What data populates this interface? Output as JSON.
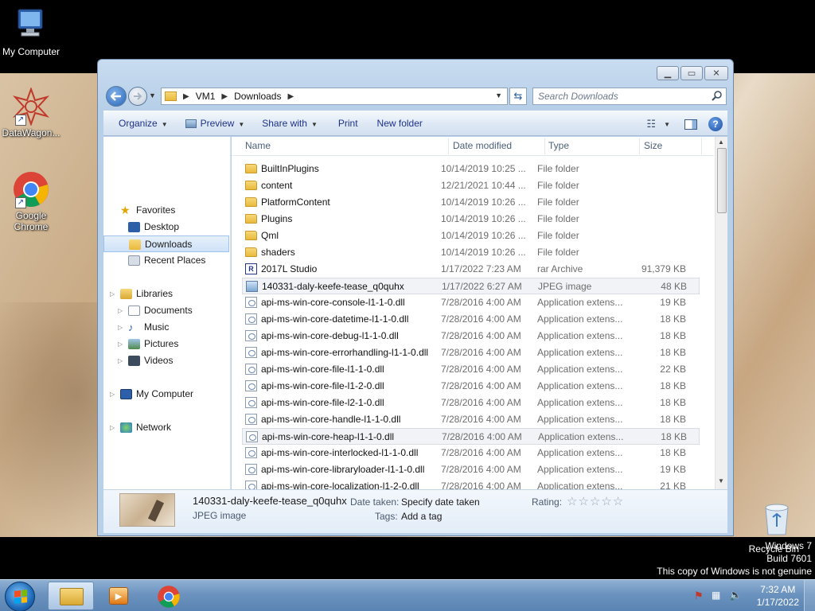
{
  "desktop": {
    "icons": [
      {
        "label": "My Computer"
      },
      {
        "label": "DataWagon..."
      },
      {
        "label": "Google Chrome"
      }
    ],
    "recycle_bin": "Recycle Bin",
    "genuine": {
      "line1": "Windows 7",
      "line2": "Build 7601",
      "line3": "This copy of Windows is not genuine"
    }
  },
  "window": {
    "address": {
      "crumbs": [
        "VM1",
        "Downloads"
      ]
    },
    "search_placeholder": "Search Downloads",
    "toolbar": {
      "organize": "Organize",
      "preview": "Preview",
      "share_with": "Share with",
      "print": "Print",
      "new_folder": "New folder"
    },
    "nav": {
      "favorites": "Favorites",
      "desktop": "Desktop",
      "downloads": "Downloads",
      "recent_places": "Recent Places",
      "libraries": "Libraries",
      "documents": "Documents",
      "music": "Music",
      "pictures": "Pictures",
      "videos": "Videos",
      "my_computer": "My Computer",
      "network": "Network"
    },
    "columns": {
      "name": "Name",
      "date": "Date modified",
      "type": "Type",
      "size": "Size"
    },
    "files": [
      {
        "name": "BuiltInPlugins",
        "date": "10/14/2019 10:25 ...",
        "type": "File folder",
        "size": "",
        "icon": "folder-icon"
      },
      {
        "name": "content",
        "date": "12/21/2021 10:44 ...",
        "type": "File folder",
        "size": "",
        "icon": "folder-icon"
      },
      {
        "name": "PlatformContent",
        "date": "10/14/2019 10:26 ...",
        "type": "File folder",
        "size": "",
        "icon": "folder-icon"
      },
      {
        "name": "Plugins",
        "date": "10/14/2019 10:26 ...",
        "type": "File folder",
        "size": "",
        "icon": "folder-icon"
      },
      {
        "name": "Qml",
        "date": "10/14/2019 10:26 ...",
        "type": "File folder",
        "size": "",
        "icon": "folder-icon"
      },
      {
        "name": "shaders",
        "date": "10/14/2019 10:26 ...",
        "type": "File folder",
        "size": "",
        "icon": "folder-icon"
      },
      {
        "name": "2017L Studio",
        "date": "1/17/2022 7:23 AM",
        "type": "rar Archive",
        "size": "91,379 KB",
        "icon": "rar-icon"
      },
      {
        "name": "140331-daly-keefe-tease_q0quhx",
        "date": "1/17/2022 6:27 AM",
        "type": "JPEG image",
        "size": "48 KB",
        "icon": "jpeg-icon"
      },
      {
        "name": "api-ms-win-core-console-l1-1-0.dll",
        "date": "7/28/2016 4:00 AM",
        "type": "Application extens...",
        "size": "19 KB",
        "icon": "dll-icon"
      },
      {
        "name": "api-ms-win-core-datetime-l1-1-0.dll",
        "date": "7/28/2016 4:00 AM",
        "type": "Application extens...",
        "size": "18 KB",
        "icon": "dll-icon"
      },
      {
        "name": "api-ms-win-core-debug-l1-1-0.dll",
        "date": "7/28/2016 4:00 AM",
        "type": "Application extens...",
        "size": "18 KB",
        "icon": "dll-icon"
      },
      {
        "name": "api-ms-win-core-errorhandling-l1-1-0.dll",
        "date": "7/28/2016 4:00 AM",
        "type": "Application extens...",
        "size": "18 KB",
        "icon": "dll-icon"
      },
      {
        "name": "api-ms-win-core-file-l1-1-0.dll",
        "date": "7/28/2016 4:00 AM",
        "type": "Application extens...",
        "size": "22 KB",
        "icon": "dll-icon"
      },
      {
        "name": "api-ms-win-core-file-l1-2-0.dll",
        "date": "7/28/2016 4:00 AM",
        "type": "Application extens...",
        "size": "18 KB",
        "icon": "dll-icon"
      },
      {
        "name": "api-ms-win-core-file-l2-1-0.dll",
        "date": "7/28/2016 4:00 AM",
        "type": "Application extens...",
        "size": "18 KB",
        "icon": "dll-icon"
      },
      {
        "name": "api-ms-win-core-handle-l1-1-0.dll",
        "date": "7/28/2016 4:00 AM",
        "type": "Application extens...",
        "size": "18 KB",
        "icon": "dll-icon"
      },
      {
        "name": "api-ms-win-core-heap-l1-1-0.dll",
        "date": "7/28/2016 4:00 AM",
        "type": "Application extens...",
        "size": "18 KB",
        "icon": "dll-icon"
      },
      {
        "name": "api-ms-win-core-interlocked-l1-1-0.dll",
        "date": "7/28/2016 4:00 AM",
        "type": "Application extens...",
        "size": "18 KB",
        "icon": "dll-icon"
      },
      {
        "name": "api-ms-win-core-libraryloader-l1-1-0.dll",
        "date": "7/28/2016 4:00 AM",
        "type": "Application extens...",
        "size": "19 KB",
        "icon": "dll-icon"
      },
      {
        "name": "api-ms-win-core-localization-l1-2-0.dll",
        "date": "7/28/2016 4:00 AM",
        "type": "Application extens...",
        "size": "21 KB",
        "icon": "dll-icon"
      }
    ],
    "details": {
      "file_name": "140331-daly-keefe-tease_q0quhx",
      "file_type": "JPEG image",
      "date_taken_label": "Date taken:",
      "date_taken_value": "Specify date taken",
      "tags_label": "Tags:",
      "tags_value": "Add a tag",
      "rating_label": "Rating:",
      "rating_stars": "☆☆☆☆☆"
    }
  },
  "taskbar": {
    "time": "7:32 AM",
    "date": "1/17/2022"
  },
  "colors": {
    "toolbar_text": "#1e3287",
    "taskbar": "#6c93bf"
  }
}
